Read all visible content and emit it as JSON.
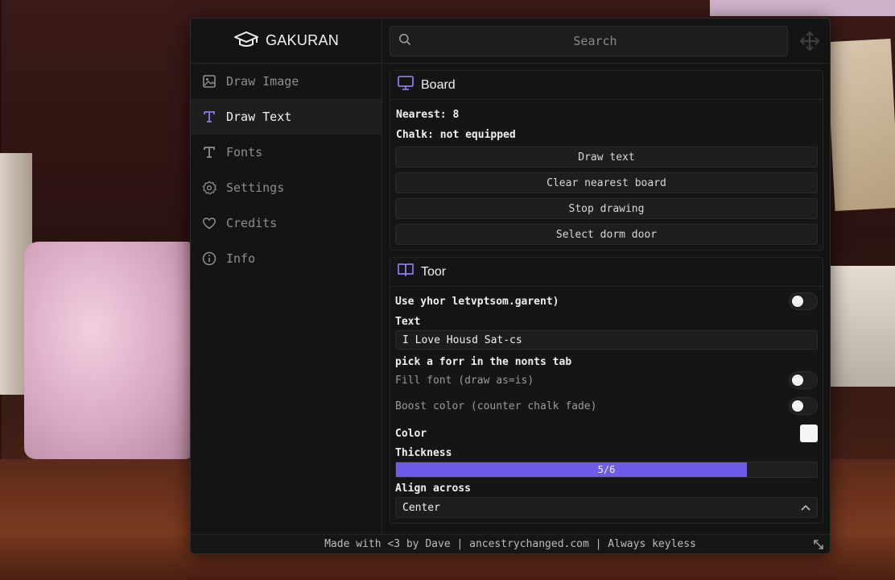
{
  "app": {
    "title": "GAKURAN"
  },
  "colors": {
    "accent": "#6f5ce6",
    "panel": "#141414",
    "text": "#f0f0f0"
  },
  "sidebar": {
    "items": [
      {
        "label": "Draw Image",
        "icon": "image-icon",
        "active": false
      },
      {
        "label": "Draw Text",
        "icon": "text-icon",
        "active": true
      },
      {
        "label": "Fonts",
        "icon": "text-icon",
        "active": false
      },
      {
        "label": "Settings",
        "icon": "gear-icon",
        "active": false
      },
      {
        "label": "Credits",
        "icon": "heart-icon",
        "active": false
      },
      {
        "label": "Info",
        "icon": "info-icon",
        "active": false
      }
    ]
  },
  "search": {
    "placeholder": "Search"
  },
  "board": {
    "title": "Board",
    "nearest": "Nearest: 8",
    "chalk": "Chalk: not equipped",
    "buttons": [
      "Draw text",
      "Clear nearest board",
      "Stop drawing",
      "Select dorm door"
    ]
  },
  "tool": {
    "title": "Toor",
    "use_toggle_label": "Use yhor letvptsom.garent)",
    "text_label": "Text",
    "text_value": "I Love Housd Sat-cs",
    "hint": "pick a forr in the nonts tab",
    "fill_font_label": "Fill font (draw as=is)",
    "boost_color_label": "Boost color (counter chalk fade)",
    "color_label": "Color",
    "color_value": "#f5f5f5",
    "thickness_label": "Thickness",
    "thickness_text": "5/6",
    "thickness_value": 5,
    "thickness_max": 6,
    "align_label": "Align across",
    "align_value": "Center"
  },
  "footer": {
    "text": "Made with <3 by Dave | ancestrychanged.com | Always keyless"
  }
}
